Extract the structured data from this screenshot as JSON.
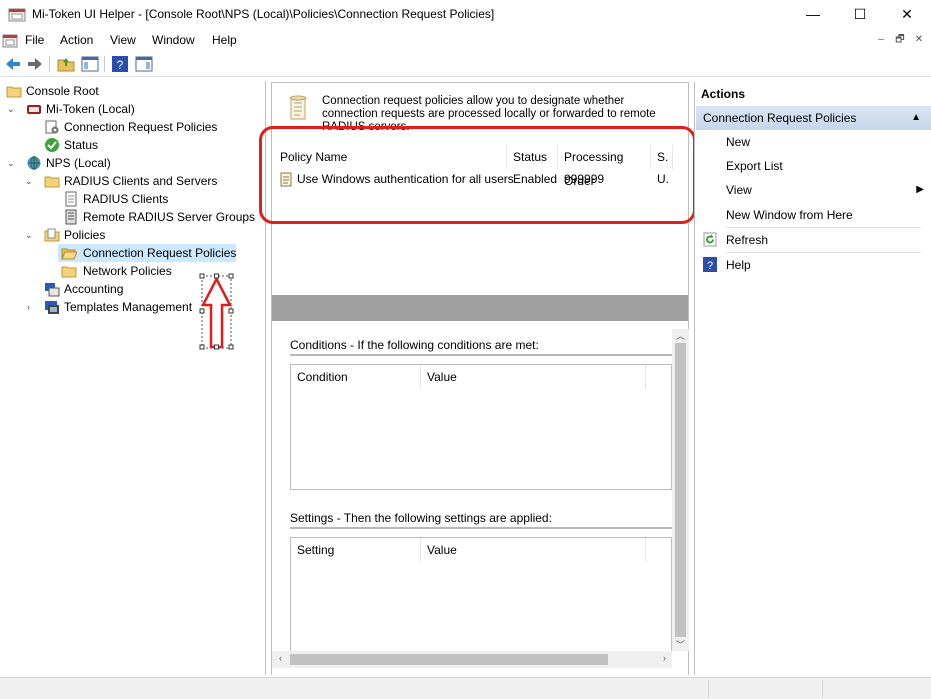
{
  "window": {
    "title": "Mi-Token UI Helper - [Console Root\\NPS (Local)\\Policies\\Connection Request Policies]",
    "minimize_glyph": "—",
    "maximize_glyph": "☐",
    "close_glyph": "✕"
  },
  "menu": {
    "items": [
      "File",
      "Action",
      "View",
      "Window",
      "Help"
    ],
    "child_controls": [
      "–",
      "🗗",
      "✕"
    ]
  },
  "toolbar": {
    "buttons": [
      "back-icon",
      "forward-icon",
      "up-folder-icon",
      "show-hide-tree-icon",
      "help-icon",
      "show-hide-action-pane-icon"
    ]
  },
  "tree": {
    "items": [
      {
        "label": "Console Root",
        "icon": "folder-icon",
        "level": 0
      },
      {
        "label": "Mi-Token (Local)",
        "icon": "mi-token-icon",
        "level": 0,
        "expanded": true
      },
      {
        "label": "Connection Request Policies",
        "icon": "policy-gear-icon",
        "level": 1
      },
      {
        "label": "Status",
        "icon": "status-check-icon",
        "level": 1
      },
      {
        "label": "NPS (Local)",
        "icon": "globe-server-icon",
        "level": 0,
        "expanded": true
      },
      {
        "label": "RADIUS Clients and Servers",
        "icon": "folder-icon",
        "level": 1,
        "expanded": true
      },
      {
        "label": "RADIUS Clients",
        "icon": "document-icon",
        "level": 2
      },
      {
        "label": "Remote RADIUS Server Groups",
        "icon": "server-group-icon",
        "level": 2
      },
      {
        "label": "Policies",
        "icon": "folder-icon",
        "level": 1,
        "expanded": true
      },
      {
        "label": "Connection Request Policies",
        "icon": "open-folder-icon",
        "level": 2,
        "selected": true
      },
      {
        "label": "Network Policies",
        "icon": "folder-icon",
        "level": 2
      },
      {
        "label": "Accounting",
        "icon": "accounting-icon",
        "level": 1
      },
      {
        "label": "Templates Management",
        "icon": "templates-icon",
        "level": 1,
        "collapsed": true
      }
    ]
  },
  "center": {
    "info_text": "Connection request policies allow you to designate whether connection requests are processed locally or forwarded to remote RADIUS servers.",
    "columns": [
      "Policy Name",
      "Status",
      "Processing Order",
      "S."
    ],
    "rows": [
      {
        "name": "Use Windows authentication for all users",
        "status": "Enabled",
        "order": "999999",
        "source": "U."
      }
    ],
    "conditions": {
      "title": "Conditions - If the following conditions are met:",
      "columns": [
        "Condition",
        "Value"
      ]
    },
    "settings": {
      "title": "Settings - Then the following settings are applied:",
      "columns": [
        "Setting",
        "Value"
      ]
    }
  },
  "actions": {
    "title": "Actions",
    "group": "Connection Request Policies",
    "items": [
      {
        "label": "New",
        "icon": ""
      },
      {
        "label": "Export List",
        "icon": ""
      },
      {
        "label": "View",
        "icon": "",
        "submenu": true
      },
      {
        "label": "New Window from Here",
        "icon": ""
      },
      {
        "label": "Refresh",
        "icon": "refresh-icon"
      },
      {
        "label": "Help",
        "icon": "help-icon"
      }
    ]
  },
  "colors": {
    "highlight": "#e01e1e",
    "selection": "#cce8ff",
    "actions_header": "#c5d5ea"
  }
}
